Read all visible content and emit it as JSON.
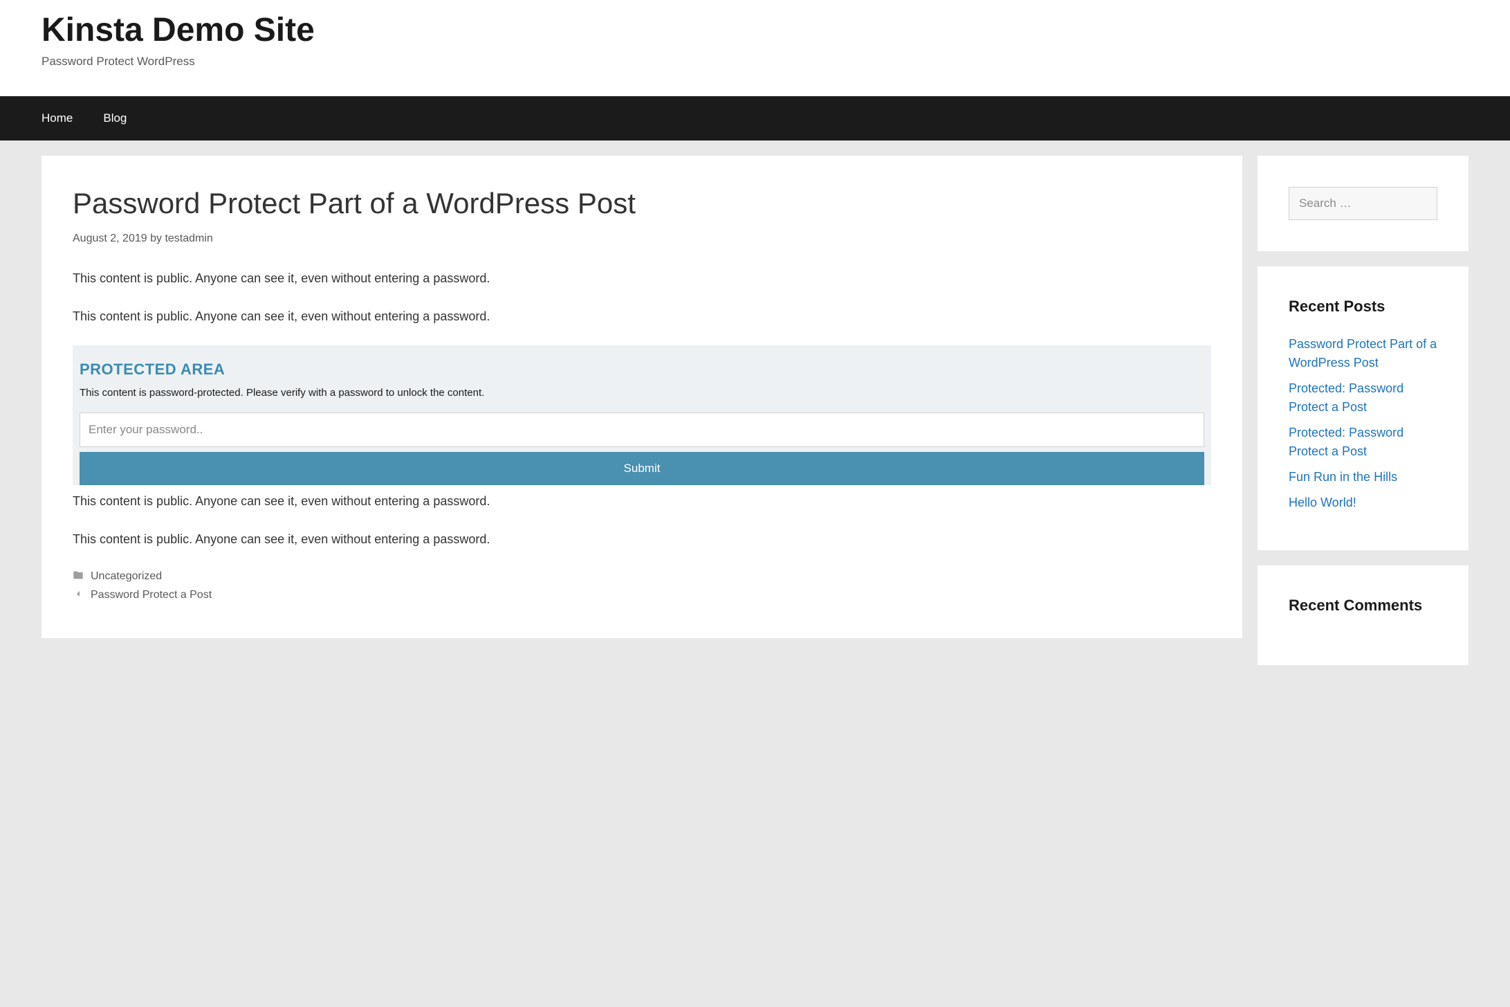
{
  "site": {
    "title": "Kinsta Demo Site",
    "tagline": "Password Protect WordPress"
  },
  "nav": {
    "items": [
      {
        "label": "Home"
      },
      {
        "label": "Blog"
      }
    ]
  },
  "post": {
    "title": "Password Protect Part of a WordPress Post",
    "date": "August 2, 2019",
    "by_label": "by",
    "author": "testadmin",
    "paragraphs": {
      "p1": "This content is public. Anyone can see it, even without entering a password.",
      "p2": "This content is public. Anyone can see it, even without entering a password.",
      "p3": "This content is public. Anyone can see it, even without entering a password.",
      "p4": "This content is public. Anyone can see it, even without entering a password."
    },
    "protected": {
      "title": "PROTECTED AREA",
      "description": "This content is password-protected. Please verify with a password to unlock the content.",
      "placeholder": "Enter your password..",
      "submit_label": "Submit"
    },
    "footer": {
      "category": "Uncategorized",
      "nav_prev": "Password Protect a Post"
    }
  },
  "sidebar": {
    "search": {
      "placeholder": "Search …"
    },
    "recent_posts": {
      "title": "Recent Posts",
      "items": [
        {
          "label": "Password Protect Part of a WordPress Post"
        },
        {
          "label": "Protected: Password Protect a Post"
        },
        {
          "label": "Protected: Password Protect a Post"
        },
        {
          "label": "Fun Run in the Hills"
        },
        {
          "label": "Hello World!"
        }
      ]
    },
    "recent_comments": {
      "title": "Recent Comments"
    }
  }
}
